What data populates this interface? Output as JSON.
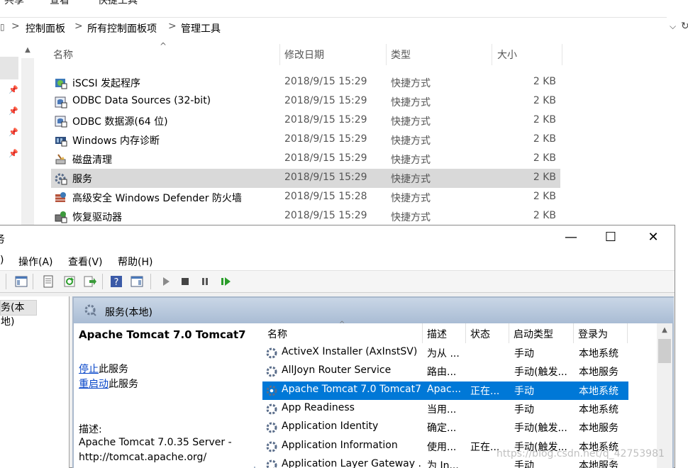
{
  "ribbon": {
    "tabs": [
      "共享",
      "查看",
      "快捷工具"
    ]
  },
  "address": {
    "segments": [
      "控制面板",
      "所有控制面板项",
      "管理工具"
    ],
    "separator": ">"
  },
  "explorer": {
    "columns": {
      "name": "名称",
      "modified": "修改日期",
      "type": "类型",
      "size": "大小"
    },
    "files": [
      {
        "name": "iSCSI 发起程序",
        "date": "2018/9/15 15:29",
        "type": "快捷方式",
        "size": "2 KB",
        "icon": "iscsi-icon"
      },
      {
        "name": "ODBC Data Sources (32-bit)",
        "date": "2018/9/15 15:29",
        "type": "快捷方式",
        "size": "2 KB",
        "icon": "odbc-icon"
      },
      {
        "name": "ODBC 数据源(64 位)",
        "date": "2018/9/15 15:29",
        "type": "快捷方式",
        "size": "2 KB",
        "icon": "odbc-icon"
      },
      {
        "name": "Windows 内存诊断",
        "date": "2018/9/15 15:29",
        "type": "快捷方式",
        "size": "2 KB",
        "icon": "memory-diagnostic-icon"
      },
      {
        "name": "磁盘清理",
        "date": "2018/9/15 15:29",
        "type": "快捷方式",
        "size": "2 KB",
        "icon": "disk-cleanup-icon"
      },
      {
        "name": "服务",
        "date": "2018/9/15 15:29",
        "type": "快捷方式",
        "size": "2 KB",
        "icon": "services-icon",
        "selected": true
      },
      {
        "name": "高级安全 Windows Defender 防火墙",
        "date": "2018/9/15 15:28",
        "type": "快捷方式",
        "size": "2 KB",
        "icon": "firewall-icon"
      },
      {
        "name": "恢复驱动器",
        "date": "2018/9/15 15:29",
        "type": "快捷方式",
        "size": "2 KB",
        "icon": "recovery-drive-icon"
      }
    ]
  },
  "services_window": {
    "title": "务",
    "controls": {
      "minimize": "—",
      "maximize": "☐",
      "close": "✕"
    },
    "menu": [
      ")",
      "操作(A)",
      "查看(V)",
      "帮助(H)"
    ],
    "tree_item": "务(本地)",
    "header_title": "服务(本地)",
    "extended": {
      "service_name": "Apache Tomcat 7.0 Tomcat7",
      "stop_link": "停止",
      "stop_suffix": "此服务",
      "restart_link": "重启动",
      "restart_suffix": "此服务",
      "desc_label": "描述:",
      "desc_line1": "Apache Tomcat 7.0.35 Server -",
      "desc_line2": "http://tomcat.apache.org/"
    },
    "columns": {
      "name": "名称",
      "desc": "描述",
      "status": "状态",
      "startup": "启动类型",
      "logon": "登录为"
    },
    "services": [
      {
        "name": "ActiveX Installer (AxInstSV)",
        "desc": "为从 ...",
        "status": "",
        "startup": "手动",
        "logon": "本地系统"
      },
      {
        "name": "AllJoyn Router Service",
        "desc": "路由...",
        "status": "",
        "startup": "手动(触发...",
        "logon": "本地服务"
      },
      {
        "name": "Apache Tomcat 7.0 Tomcat7",
        "desc": "Apac...",
        "status": "正在...",
        "startup": "手动",
        "logon": "本地系统",
        "selected": true
      },
      {
        "name": "App Readiness",
        "desc": "当用...",
        "status": "",
        "startup": "手动",
        "logon": "本地系统"
      },
      {
        "name": "Application Identity",
        "desc": "确定...",
        "status": "",
        "startup": "手动(触发...",
        "logon": "本地服务"
      },
      {
        "name": "Application Information",
        "desc": "使用...",
        "status": "正在...",
        "startup": "手动(触发...",
        "logon": "本地系统"
      },
      {
        "name": "Application Layer Gateway ...",
        "desc": "为 In...",
        "status": "",
        "startup": "手动",
        "logon": "本地服务"
      }
    ]
  },
  "watermark": "https://blog.csdn.net/q_42753981",
  "colors": {
    "selection_blue": "#0078d7",
    "header_gradient": "#a9bcd4",
    "link": "#0645c8"
  }
}
